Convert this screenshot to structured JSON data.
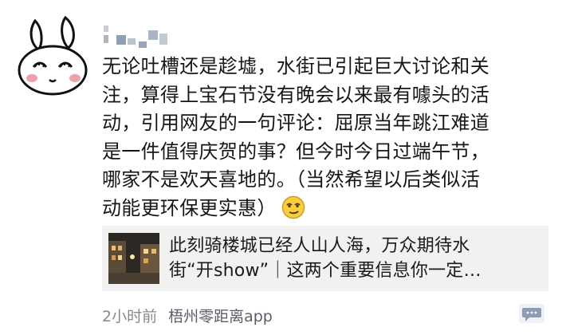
{
  "post": {
    "author_avatar_icon": "rabbit-avatar-icon",
    "author_name_obscured": true,
    "text": "无论吐槽还是趁墟，水街已引起巨大讨论和关\n注，算得上宝石节没有晚会以来最有噱头的活\n动，引用网友的一句评论：屈原当年跳江难道\n是一件值得庆贺的事？但今时今日过端午节，\n哪家不是欢天喜地的。（当然希望以后类似活\n动能更环保更实惠）",
    "emoji_icon": "smirk-emoji-icon"
  },
  "link_card": {
    "thumbnail_icon": "night-street-thumbnail",
    "title": "此刻骑楼城已经人山人海，万众期待水\n街“开show”｜这两个重要信息你一定…"
  },
  "meta": {
    "time": "2小时前",
    "source": "梧州零距离app",
    "comment_icon": "comment-bubble-icon"
  },
  "colors": {
    "card_background": "#f1f1f1",
    "meta_gray": "#8a8a8a",
    "link_blue": "#595e6b",
    "comment_icon_blue": "#8e9bb5"
  }
}
